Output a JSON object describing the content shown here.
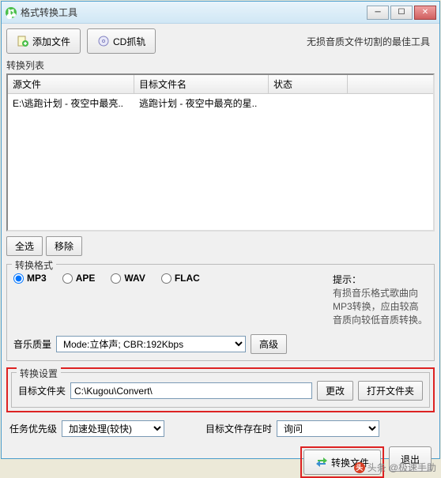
{
  "window": {
    "title": "格式转换工具"
  },
  "toolbar": {
    "add_file": "添加文件",
    "cd_rip": "CD抓轨",
    "tagline": "无损音质文件切割的最佳工具"
  },
  "list": {
    "label": "转换列表",
    "headers": {
      "source": "源文件",
      "target": "目标文件名",
      "status": "状态"
    },
    "rows": [
      {
        "source": "E:\\逃跑计划 - 夜空中最亮..",
        "target": "逃跑计划 - 夜空中最亮的星..",
        "status": ""
      }
    ],
    "select_all": "全选",
    "remove": "移除"
  },
  "format": {
    "group_title": "转换格式",
    "options": {
      "mp3": "MP3",
      "ape": "APE",
      "wav": "WAV",
      "flac": "FLAC"
    },
    "tip_title": "提示：",
    "tip_body": "有损音乐格式歌曲向MP3转换，应由较高音质向较低音质转换。",
    "quality_label": "音乐质量",
    "quality_value": "Mode:立体声; CBR:192Kbps",
    "advanced": "高级"
  },
  "settings": {
    "group_title": "转换设置",
    "target_label": "目标文件夹",
    "target_path": "C:\\Kugou\\Convert\\",
    "change": "更改",
    "open_folder": "打开文件夹"
  },
  "priority": {
    "label": "任务优先级",
    "value": "加速处理(较快)",
    "exists_label": "目标文件存在时",
    "exists_value": "询问"
  },
  "actions": {
    "convert": "转换文件",
    "exit": "退出"
  },
  "attribution": {
    "source": "头条",
    "author": "@极速手助"
  }
}
